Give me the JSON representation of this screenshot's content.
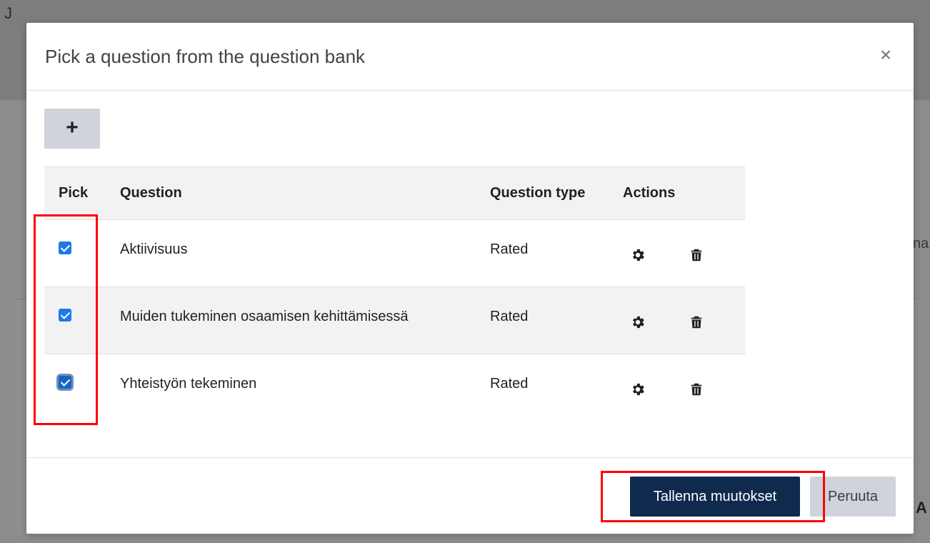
{
  "background": {
    "left_glyph": "J",
    "right_text": "na",
    "right_bold": "A"
  },
  "modal": {
    "title": "Pick a question from the question bank",
    "close_label": "×",
    "add_label": "+"
  },
  "table": {
    "headers": {
      "pick": "Pick",
      "question": "Question",
      "type": "Question type",
      "actions": "Actions"
    },
    "rows": [
      {
        "question": "Aktiivisuus",
        "type": "Rated",
        "checked": true
      },
      {
        "question": "Muiden tukeminen osaamisen kehittämisessä",
        "type": "Rated",
        "checked": true
      },
      {
        "question": "Yhteistyön tekeminen",
        "type": "Rated",
        "checked": true
      }
    ]
  },
  "footer": {
    "save_label": "Tallenna muutokset",
    "cancel_label": "Peruuta"
  },
  "colors": {
    "primary": "#0f2a4d",
    "checkbox": "#1c7ae6",
    "highlight": "#ff0000"
  },
  "icons": {
    "edit": "gear-icon",
    "delete": "trash-icon",
    "close": "close-icon",
    "add": "plus-icon"
  }
}
